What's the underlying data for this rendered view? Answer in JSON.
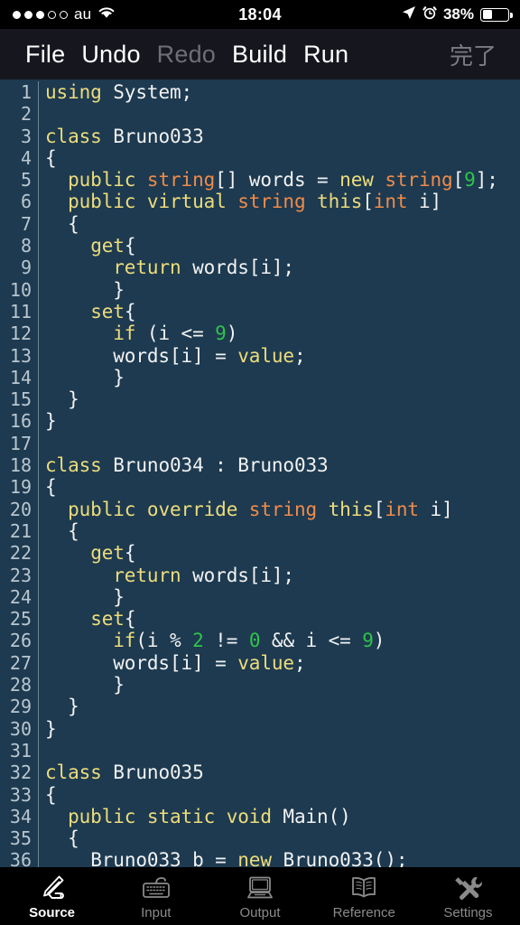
{
  "status_bar": {
    "signal_dots_total": 5,
    "signal_dots_filled": 3,
    "carrier": "au",
    "wifi_icon": "wifi-icon",
    "time": "18:04",
    "location_icon": "location-arrow-icon",
    "alarm_icon": "alarm-clock-icon",
    "battery_percent": "38%",
    "battery_level": 38
  },
  "toolbar": {
    "items": [
      {
        "label": "File",
        "disabled": false
      },
      {
        "label": "Undo",
        "disabled": false
      },
      {
        "label": "Redo",
        "disabled": true
      },
      {
        "label": "Build",
        "disabled": false
      },
      {
        "label": "Run",
        "disabled": false
      }
    ],
    "done_label": "完了",
    "done_disabled": true
  },
  "editor": {
    "language": "csharp",
    "first_visible_line": 1,
    "last_visible_line": 36,
    "colors": {
      "background": "#1D3A50",
      "gutter_text": "#B9C6CF",
      "gutter_rule": "#6E8494",
      "plain": "#F2F2F2",
      "keyword": "#EDDC7B",
      "type": "#F08B4A",
      "number": "#2FC44B"
    },
    "lines": [
      {
        "n": 1,
        "tokens": [
          {
            "t": "using ",
            "c": "kw"
          },
          {
            "t": "System;",
            "c": "pln"
          }
        ]
      },
      {
        "n": 2,
        "tokens": []
      },
      {
        "n": 3,
        "tokens": [
          {
            "t": "class ",
            "c": "kw"
          },
          {
            "t": "Bruno033",
            "c": "pln"
          }
        ]
      },
      {
        "n": 4,
        "tokens": [
          {
            "t": "{",
            "c": "pln"
          }
        ]
      },
      {
        "n": 5,
        "tokens": [
          {
            "t": "  ",
            "c": "pln"
          },
          {
            "t": "public ",
            "c": "kw"
          },
          {
            "t": "string",
            "c": "typ"
          },
          {
            "t": "[] words = ",
            "c": "pln"
          },
          {
            "t": "new ",
            "c": "kw"
          },
          {
            "t": "string",
            "c": "typ"
          },
          {
            "t": "[",
            "c": "pln"
          },
          {
            "t": "9",
            "c": "num"
          },
          {
            "t": "];",
            "c": "pln"
          }
        ]
      },
      {
        "n": 6,
        "tokens": [
          {
            "t": "  ",
            "c": "pln"
          },
          {
            "t": "public virtual ",
            "c": "kw"
          },
          {
            "t": "string ",
            "c": "typ"
          },
          {
            "t": "this",
            "c": "kw"
          },
          {
            "t": "[",
            "c": "pln"
          },
          {
            "t": "int",
            "c": "typ"
          },
          {
            "t": " i]",
            "c": "pln"
          }
        ]
      },
      {
        "n": 7,
        "tokens": [
          {
            "t": "  {",
            "c": "pln"
          }
        ]
      },
      {
        "n": 8,
        "tokens": [
          {
            "t": "    ",
            "c": "pln"
          },
          {
            "t": "get",
            "c": "kw"
          },
          {
            "t": "{",
            "c": "pln"
          }
        ]
      },
      {
        "n": 9,
        "tokens": [
          {
            "t": "      ",
            "c": "pln"
          },
          {
            "t": "return ",
            "c": "kw"
          },
          {
            "t": "words[i];",
            "c": "pln"
          }
        ]
      },
      {
        "n": 10,
        "tokens": [
          {
            "t": "      }",
            "c": "pln"
          }
        ]
      },
      {
        "n": 11,
        "tokens": [
          {
            "t": "    ",
            "c": "pln"
          },
          {
            "t": "set",
            "c": "kw"
          },
          {
            "t": "{",
            "c": "pln"
          }
        ]
      },
      {
        "n": 12,
        "tokens": [
          {
            "t": "      ",
            "c": "pln"
          },
          {
            "t": "if",
            "c": "kw"
          },
          {
            "t": " (i <= ",
            "c": "pln"
          },
          {
            "t": "9",
            "c": "num"
          },
          {
            "t": ")",
            "c": "pln"
          }
        ]
      },
      {
        "n": 13,
        "tokens": [
          {
            "t": "      words[i] = ",
            "c": "pln"
          },
          {
            "t": "value",
            "c": "kw"
          },
          {
            "t": ";",
            "c": "pln"
          }
        ]
      },
      {
        "n": 14,
        "tokens": [
          {
            "t": "      }",
            "c": "pln"
          }
        ]
      },
      {
        "n": 15,
        "tokens": [
          {
            "t": "  }",
            "c": "pln"
          }
        ]
      },
      {
        "n": 16,
        "tokens": [
          {
            "t": "}",
            "c": "pln"
          }
        ]
      },
      {
        "n": 17,
        "tokens": []
      },
      {
        "n": 18,
        "tokens": [
          {
            "t": "class ",
            "c": "kw"
          },
          {
            "t": "Bruno034 : Bruno033",
            "c": "pln"
          }
        ]
      },
      {
        "n": 19,
        "tokens": [
          {
            "t": "{",
            "c": "pln"
          }
        ]
      },
      {
        "n": 20,
        "tokens": [
          {
            "t": "  ",
            "c": "pln"
          },
          {
            "t": "public override ",
            "c": "kw"
          },
          {
            "t": "string ",
            "c": "typ"
          },
          {
            "t": "this",
            "c": "kw"
          },
          {
            "t": "[",
            "c": "pln"
          },
          {
            "t": "int",
            "c": "typ"
          },
          {
            "t": " i]",
            "c": "pln"
          }
        ]
      },
      {
        "n": 21,
        "tokens": [
          {
            "t": "  {",
            "c": "pln"
          }
        ]
      },
      {
        "n": 22,
        "tokens": [
          {
            "t": "    ",
            "c": "pln"
          },
          {
            "t": "get",
            "c": "kw"
          },
          {
            "t": "{",
            "c": "pln"
          }
        ]
      },
      {
        "n": 23,
        "tokens": [
          {
            "t": "      ",
            "c": "pln"
          },
          {
            "t": "return ",
            "c": "kw"
          },
          {
            "t": "words[i];",
            "c": "pln"
          }
        ]
      },
      {
        "n": 24,
        "tokens": [
          {
            "t": "      }",
            "c": "pln"
          }
        ]
      },
      {
        "n": 25,
        "tokens": [
          {
            "t": "    ",
            "c": "pln"
          },
          {
            "t": "set",
            "c": "kw"
          },
          {
            "t": "{",
            "c": "pln"
          }
        ]
      },
      {
        "n": 26,
        "tokens": [
          {
            "t": "      ",
            "c": "pln"
          },
          {
            "t": "if",
            "c": "kw"
          },
          {
            "t": "(i % ",
            "c": "pln"
          },
          {
            "t": "2",
            "c": "num"
          },
          {
            "t": " != ",
            "c": "pln"
          },
          {
            "t": "0",
            "c": "num"
          },
          {
            "t": " && i <= ",
            "c": "pln"
          },
          {
            "t": "9",
            "c": "num"
          },
          {
            "t": ")",
            "c": "pln"
          }
        ]
      },
      {
        "n": 27,
        "tokens": [
          {
            "t": "      words[i] = ",
            "c": "pln"
          },
          {
            "t": "value",
            "c": "kw"
          },
          {
            "t": ";",
            "c": "pln"
          }
        ]
      },
      {
        "n": 28,
        "tokens": [
          {
            "t": "      }",
            "c": "pln"
          }
        ]
      },
      {
        "n": 29,
        "tokens": [
          {
            "t": "  }",
            "c": "pln"
          }
        ]
      },
      {
        "n": 30,
        "tokens": [
          {
            "t": "}",
            "c": "pln"
          }
        ]
      },
      {
        "n": 31,
        "tokens": []
      },
      {
        "n": 32,
        "tokens": [
          {
            "t": "class ",
            "c": "kw"
          },
          {
            "t": "Bruno035",
            "c": "pln"
          }
        ]
      },
      {
        "n": 33,
        "tokens": [
          {
            "t": "{",
            "c": "pln"
          }
        ]
      },
      {
        "n": 34,
        "tokens": [
          {
            "t": "  ",
            "c": "pln"
          },
          {
            "t": "public static void ",
            "c": "kw"
          },
          {
            "t": "Main()",
            "c": "pln"
          }
        ]
      },
      {
        "n": 35,
        "tokens": [
          {
            "t": "  {",
            "c": "pln"
          }
        ]
      },
      {
        "n": 36,
        "tokens": [
          {
            "t": "    ",
            "c": "pln"
          },
          {
            "t": "Bruno033 b = ",
            "c": "pln"
          },
          {
            "t": "new ",
            "c": "kw"
          },
          {
            "t": "Bruno033();",
            "c": "pln"
          }
        ]
      }
    ]
  },
  "tab_bar": {
    "tabs": [
      {
        "label": "Source",
        "icon": "hand-writing-icon",
        "active": true
      },
      {
        "label": "Input",
        "icon": "keyboard-icon",
        "active": false
      },
      {
        "label": "Output",
        "icon": "monitor-icon",
        "active": false
      },
      {
        "label": "Reference",
        "icon": "open-book-icon",
        "active": false
      },
      {
        "label": "Settings",
        "icon": "tools-icon",
        "active": false
      }
    ]
  }
}
